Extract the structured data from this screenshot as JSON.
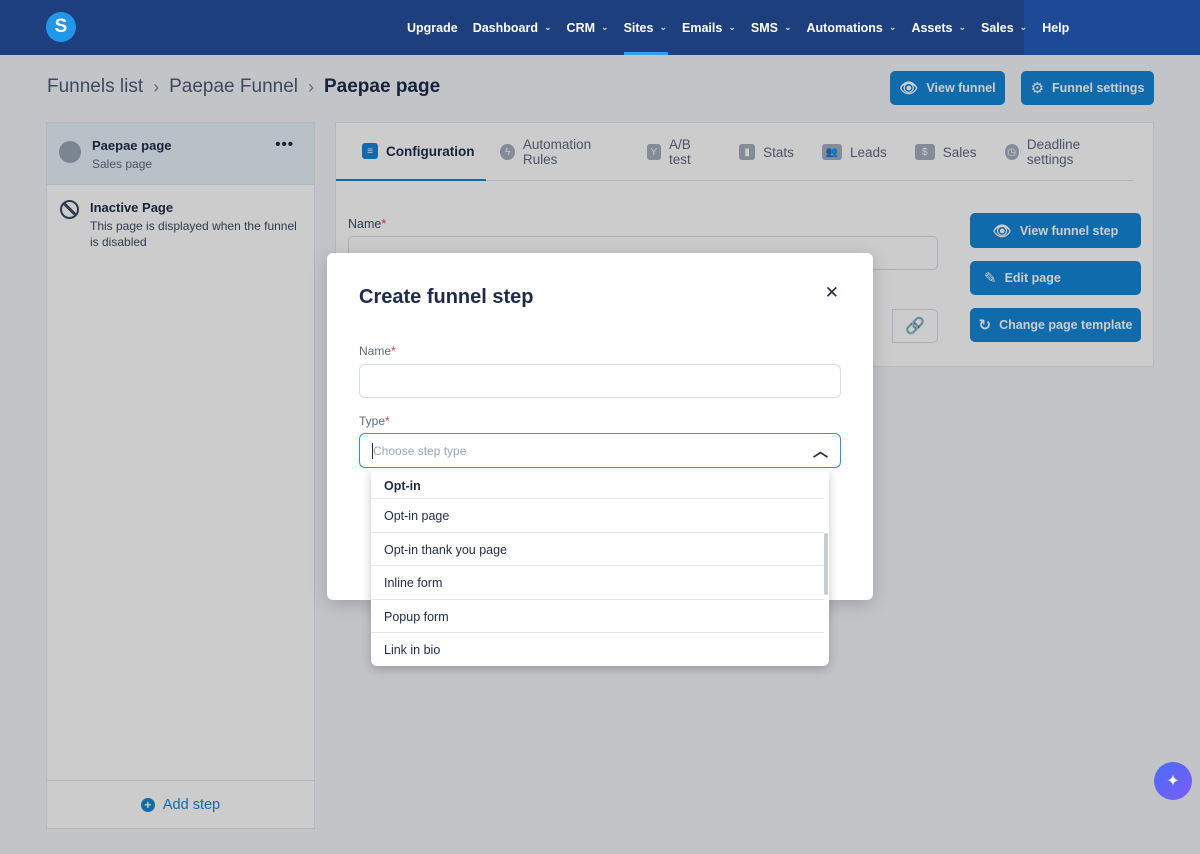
{
  "nav": {
    "logo": "S",
    "items": [
      {
        "label": "Upgrade",
        "caret": false
      },
      {
        "label": "Dashboard",
        "caret": true
      },
      {
        "label": "CRM",
        "caret": true
      },
      {
        "label": "Sites",
        "caret": true,
        "active": true
      },
      {
        "label": "Emails",
        "caret": true
      },
      {
        "label": "SMS",
        "caret": true
      },
      {
        "label": "Automations",
        "caret": true
      },
      {
        "label": "Assets",
        "caret": true
      },
      {
        "label": "Sales",
        "caret": true
      },
      {
        "label": "Help",
        "caret": false
      }
    ]
  },
  "breadcrumb": {
    "items": [
      "Funnels list",
      "Paepae Funnel",
      "Paepae page"
    ]
  },
  "header": {
    "view_funnel": "View funnel",
    "funnel_settings": "Funnel settings"
  },
  "sidebar": {
    "active_step": {
      "name": "Paepae page",
      "type": "Sales page"
    },
    "inactive": {
      "title": "Inactive Page",
      "description": "This page is displayed when the funnel is disabled"
    },
    "add_step": "Add step"
  },
  "tabs": [
    {
      "label": "Configuration",
      "icon": "sliders-icon"
    },
    {
      "label": "Automation Rules",
      "icon": "bolt-icon"
    },
    {
      "label": "A/B test",
      "icon": "split-icon"
    },
    {
      "label": "Stats",
      "icon": "bar-chart-icon"
    },
    {
      "label": "Leads",
      "icon": "users-icon"
    },
    {
      "label": "Sales",
      "icon": "dollar-icon"
    },
    {
      "label": "Deadline settings",
      "icon": "clock-icon"
    }
  ],
  "config": {
    "name_label": "Name",
    "view_step": "View funnel step",
    "edit_page": "Edit page",
    "change_template": "Change page template"
  },
  "modal": {
    "title": "Create funnel step",
    "name_label": "Name",
    "type_label": "Type",
    "type_placeholder": "Choose step type"
  },
  "dropdown": {
    "group": "Opt-in",
    "options": [
      "Opt-in page",
      "Opt-in thank you page",
      "Inline form",
      "Popup form",
      "Link in bio"
    ]
  },
  "colors": {
    "primary": "#1486d8",
    "nav_bg": "#1e3f7e",
    "required": "#e53b4e"
  }
}
